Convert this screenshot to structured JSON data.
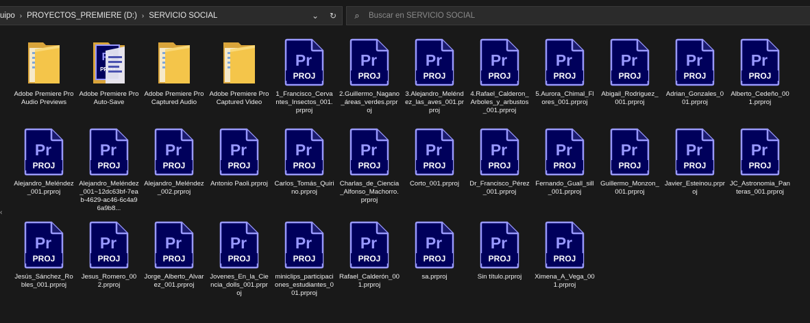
{
  "address": {
    "crumbs": [
      "uipo",
      "PROYECTOS_PREMIERE (D:)",
      "SERVICIO SOCIAL"
    ],
    "dropdown_icon": "chevron-down-icon",
    "refresh_icon": "refresh-icon"
  },
  "search": {
    "placeholder": "Buscar en SERVICIO SOCIAL",
    "icon": "search-icon"
  },
  "icon_text": {
    "pr": "Pr",
    "proj": "PROJ",
    "prproj_badge": "PROJ"
  },
  "colors": {
    "background": "#191919",
    "pr_dark": "#00005b",
    "pr_accent": "#9999ff",
    "folder": "#f4c54a"
  },
  "files": [
    {
      "type": "folder",
      "label": "Adobe Premiere Pro Audio Previews"
    },
    {
      "type": "folder-prproj",
      "label": "Adobe Premiere Pro Auto-Save"
    },
    {
      "type": "folder",
      "label": "Adobe Premiere Pro Captured Audio"
    },
    {
      "type": "folder",
      "label": "Adobe Premiere Pro Captured Video"
    },
    {
      "type": "prproj",
      "label": "1_Francisco_Cervantes_Insectos_001.prproj"
    },
    {
      "type": "prproj",
      "label": "2.Guillermo_Nagano_áreas_verdes.prproj"
    },
    {
      "type": "prproj",
      "label": "3.Alejandro_Meléndez_las_aves_001.prproj"
    },
    {
      "type": "prproj",
      "label": "4.Rafael_Calderon_Arboles_y_arbustos_001.prproj"
    },
    {
      "type": "prproj",
      "label": "5.Aurora_Chimal_Flores_001.prproj"
    },
    {
      "type": "prproj",
      "label": "Abigail_Rodriguez_001.prproj"
    },
    {
      "type": "prproj",
      "label": "Adrian_Gonzales_001.prproj"
    },
    {
      "type": "prproj",
      "label": "Alberto_Cedeño_001.prproj"
    },
    {
      "type": "prproj",
      "label": "Alejandro_Meléndez_001.prproj"
    },
    {
      "type": "prproj",
      "label": "Alejandro_Meléndez_001~12dc63bf-7eab-4629-ac46-6c4a96a9b8..."
    },
    {
      "type": "prproj",
      "label": "Alejandro_Meléndez_002.prproj"
    },
    {
      "type": "prproj",
      "label": "Antonio Paoli.prproj"
    },
    {
      "type": "prproj",
      "label": "Carlos_Tomás_Quirino.prproj"
    },
    {
      "type": "prproj",
      "label": "Charlas_de_Ciencia_Alfonso_Machorro.prproj"
    },
    {
      "type": "prproj",
      "label": "Corto_001.prproj"
    },
    {
      "type": "prproj",
      "label": "Dr_Francisco_Pérez_001.prproj"
    },
    {
      "type": "prproj",
      "label": "Fernando_Guall_sill_001.prproj"
    },
    {
      "type": "prproj",
      "label": "Guillermo_Monzon_001.prproj"
    },
    {
      "type": "prproj",
      "label": "Javier_Esteinou.prproj"
    },
    {
      "type": "prproj",
      "label": "JC_Astronomia_Panteras_001.prproj"
    },
    {
      "type": "prproj",
      "label": "Jesús_Sánchez_Robles_001.prproj"
    },
    {
      "type": "prproj",
      "label": "Jesus_Romero_002.prproj"
    },
    {
      "type": "prproj",
      "label": "Jorge_Alberto_Alvarez_001.prproj"
    },
    {
      "type": "prproj",
      "label": "Jovenes_En_la_Ciencia_dolls_001.prproj"
    },
    {
      "type": "prproj",
      "label": "miniclips_participaciones_estudiantes_001.prproj"
    },
    {
      "type": "prproj",
      "label": "Rafael_Calderón_001.prproj"
    },
    {
      "type": "prproj",
      "label": "sa.prproj"
    },
    {
      "type": "prproj",
      "label": "Sin título.prproj"
    },
    {
      "type": "prproj",
      "label": "Ximena_A_Vega_001.prproj"
    }
  ]
}
